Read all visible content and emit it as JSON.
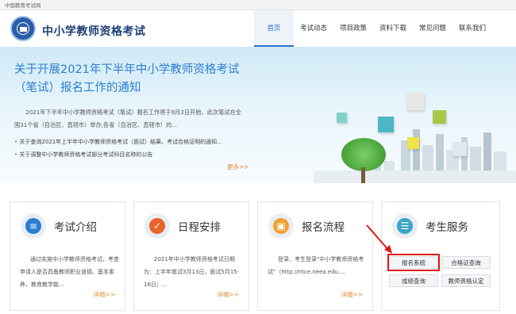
{
  "topbar": {
    "text": "中国教育考试网"
  },
  "header": {
    "site_title": "中小学教师资格考试"
  },
  "nav": {
    "items": [
      {
        "label": "首页",
        "active": true
      },
      {
        "label": "考试动态",
        "active": false
      },
      {
        "label": "项目政策",
        "active": false
      },
      {
        "label": "资料下载",
        "active": false
      },
      {
        "label": "常见问题",
        "active": false
      },
      {
        "label": "联系我们",
        "active": false
      }
    ]
  },
  "banner": {
    "title": "关于开展2021年下半年中小学教师资格考试（笔试）报名工作的通知",
    "paragraph": "2021年下半年中小学教师资格考试（笔试）报名工作将于9月2日开始，此次笔试在全国31个省（自治区、直辖市）举办,各省（自治区、直辖市）的...",
    "bullets": [
      "关于查询2021年上半年中小学教师资格考试（面试）结果、考试合格证明的通知...",
      "关于调整中小学教师资格考试部分考试科目名称的公告"
    ],
    "more": "更多>>"
  },
  "cards": [
    {
      "title": "考试介绍",
      "text": "通过实施中小学教师资格考试，考查申请人是否具备教师职业道德、基本素养、教育教学能...",
      "more": "详细>>",
      "icon": "document-icon",
      "color": "#2a7fd0"
    },
    {
      "title": "日程安排",
      "text": "2021年中小学教师资格考试日期为：上半年笔试3月13日，面试5月15-16日；...",
      "more": "详细>>",
      "icon": "check-icon",
      "color": "#e8632a"
    },
    {
      "title": "报名流程",
      "text": "登录、考生登录\"中小学教师资格考试\"（http://ntce.neea.edu....",
      "more": "详细>>",
      "icon": "browser-icon",
      "color": "#f0a030"
    },
    {
      "title": "考生服务",
      "icon": "id-card-icon",
      "color": "#3aa6c9"
    }
  ],
  "services": {
    "buttons": [
      {
        "label": "报名系统",
        "highlighted": true
      },
      {
        "label": "合格证查询",
        "highlighted": false
      },
      {
        "label": "成绩查询",
        "highlighted": false
      },
      {
        "label": "教师资格认定",
        "highlighted": false
      }
    ]
  },
  "colors": {
    "primary": "#2a7fd0",
    "accent_orange": "#e58a2e",
    "highlight_red": "#e01818",
    "title_navy": "#1e3f78"
  }
}
